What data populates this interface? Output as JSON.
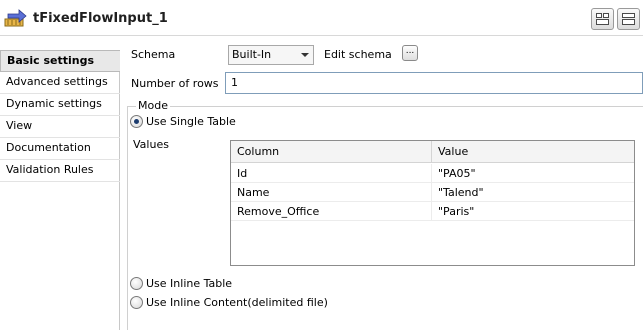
{
  "header": {
    "title": "tFixedFlowInput_1",
    "component_icon": "fixed-flow-input-icon",
    "buttons": [
      "layout-tabs-icon",
      "layout-split-icon"
    ]
  },
  "sidebar": {
    "items": [
      {
        "label": "Basic settings",
        "active": true
      },
      {
        "label": "Advanced settings"
      },
      {
        "label": "Dynamic settings"
      },
      {
        "label": "View"
      },
      {
        "label": "Documentation"
      },
      {
        "label": "Validation Rules"
      }
    ]
  },
  "settings": {
    "schema_label": "Schema",
    "schema_value": "Built-In",
    "edit_schema_label": "Edit schema",
    "edit_schema_button": "...",
    "rows_label": "Number of rows",
    "rows_value": "1",
    "mode_label": "Mode",
    "single_table_label": "Use Single Table",
    "values_label": "Values",
    "inline_table_label": "Use Inline Table",
    "inline_content_label": "Use Inline Content(delimited file)",
    "selected_mode": "Use Single Table"
  },
  "table": {
    "columns": [
      "Column",
      "Value"
    ],
    "rows": [
      [
        "Id",
        "\"PA05\""
      ],
      [
        "Name",
        "\"Talend\""
      ],
      [
        "Remove_Office",
        "\"Paris\""
      ]
    ]
  },
  "colors": {
    "active_tab_bg": "#e8e8e8",
    "radio_dot": "#1c3c6e",
    "input_border": "#7f9db9"
  }
}
